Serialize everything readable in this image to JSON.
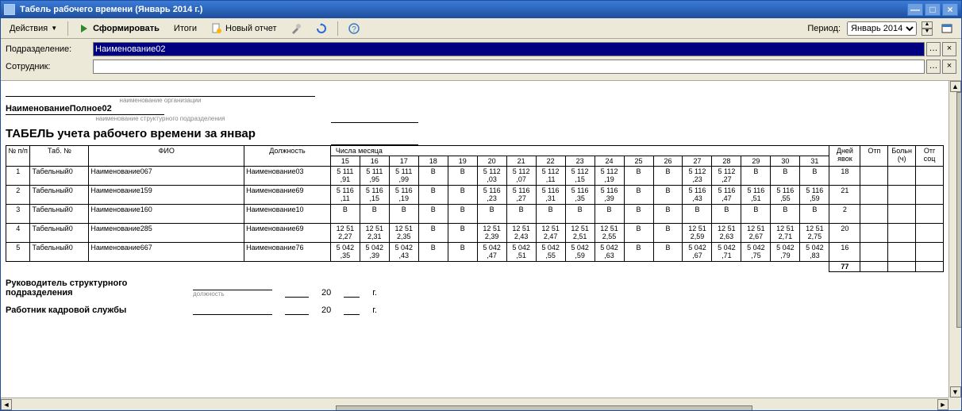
{
  "window": {
    "title": "Табель рабочего времени (Январь 2014 г.)"
  },
  "toolbar": {
    "actions": "Действия",
    "form": "Сформировать",
    "totals": "Итоги",
    "new_report": "Новый отчет",
    "period_label": "Период:",
    "period_value": "Январь 2014"
  },
  "filters": {
    "dept_label": "Подразделение:",
    "dept_value": "Наименование02",
    "emp_label": "Сотрудник:",
    "emp_value": ""
  },
  "report": {
    "org_caption": "наименование организации",
    "org_full": "НаименованиеПолное02",
    "dept_caption": "наименование структурного подразделения",
    "title": "ТАБЕЛЬ учета рабочего времени за январ",
    "col_num": "№ п/п",
    "col_tab": "Таб. №",
    "col_fio": "ФИО",
    "col_pos": "Должность",
    "col_month_days": "Числа месяца",
    "col_days_att": "Дней явок",
    "col_vac": "Отп",
    "col_sick": "Больн (ч)",
    "col_day_off": "Отг соц",
    "days": [
      "15",
      "16",
      "17",
      "18",
      "19",
      "20",
      "21",
      "22",
      "23",
      "24",
      "25",
      "26",
      "27",
      "28",
      "29",
      "30",
      "31"
    ],
    "rows": [
      {
        "n": "1",
        "tab": "Табельный0",
        "fio": "Наименование067",
        "pos": "Наименование03",
        "cells": [
          "5 111\n,91",
          "5 111\n,95",
          "5 111\n,99",
          "В",
          "В",
          "5 112\n,03",
          "5 112\n,07",
          "5 112\n,11",
          "5 112\n,15",
          "5 112\n,19",
          "В",
          "В",
          "5 112\n,23",
          "5 112\n,27",
          "В",
          "В",
          "В"
        ],
        "days": "18",
        "vac": "",
        "sick": "",
        "off": ""
      },
      {
        "n": "2",
        "tab": "Табельный0",
        "fio": "Наименование159",
        "pos": "Наименование69",
        "cells": [
          "5 116\n,11",
          "5 116\n,15",
          "5 116\n,19",
          "В",
          "В",
          "5 116\n,23",
          "5 116\n,27",
          "5 116\n,31",
          "5 116\n,35",
          "5 116\n,39",
          "В",
          "В",
          "5 116\n,43",
          "5 116\n,47",
          "5 116\n,51",
          "5 116\n,55",
          "5 116\n,59"
        ],
        "days": "21",
        "vac": "",
        "sick": "",
        "off": ""
      },
      {
        "n": "3",
        "tab": "Табельный0",
        "fio": "Наименование160",
        "pos": "Наименование10",
        "cells": [
          "В",
          "В",
          "В",
          "В",
          "В",
          "В",
          "В",
          "В",
          "В",
          "В",
          "В",
          "В",
          "В",
          "В",
          "В",
          "В",
          "В"
        ],
        "days": "2",
        "vac": "",
        "sick": "",
        "off": ""
      },
      {
        "n": "4",
        "tab": "Табельный0",
        "fio": "Наименование285",
        "pos": "Наименование69",
        "cells": [
          "12 51\n2,27",
          "12 51\n2,31",
          "12 51\n2,35",
          "В",
          "В",
          "12 51\n2,39",
          "12 51\n2,43",
          "12 51\n2,47",
          "12 51\n2,51",
          "12 51\n2,55",
          "В",
          "В",
          "12 51\n2,59",
          "12 51\n2,63",
          "12 51\n2,67",
          "12 51\n2,71",
          "12 51\n2,75"
        ],
        "days": "20",
        "vac": "",
        "sick": "",
        "off": ""
      },
      {
        "n": "5",
        "tab": "Табельный0",
        "fio": "Наименование667",
        "pos": "Наименование76",
        "cells": [
          "5 042\n,35",
          "5 042\n,39",
          "5 042\n,43",
          "В",
          "В",
          "5 042\n,47",
          "5 042\n,51",
          "5 042\n,55",
          "5 042\n,59",
          "5 042\n,63",
          "В",
          "В",
          "5 042\n,67",
          "5 042\n,71",
          "5 042\n,75",
          "5 042\n,79",
          "5 042\n,83"
        ],
        "days": "16",
        "vac": "",
        "sick": "",
        "off": ""
      }
    ],
    "total_days": "77",
    "sig_head": "Руководитель структурного подразделения",
    "sig_hr": "Работник кадровой службы",
    "sig_year": "20",
    "sig_g": "г.",
    "sig_pos_caption": "должность"
  }
}
